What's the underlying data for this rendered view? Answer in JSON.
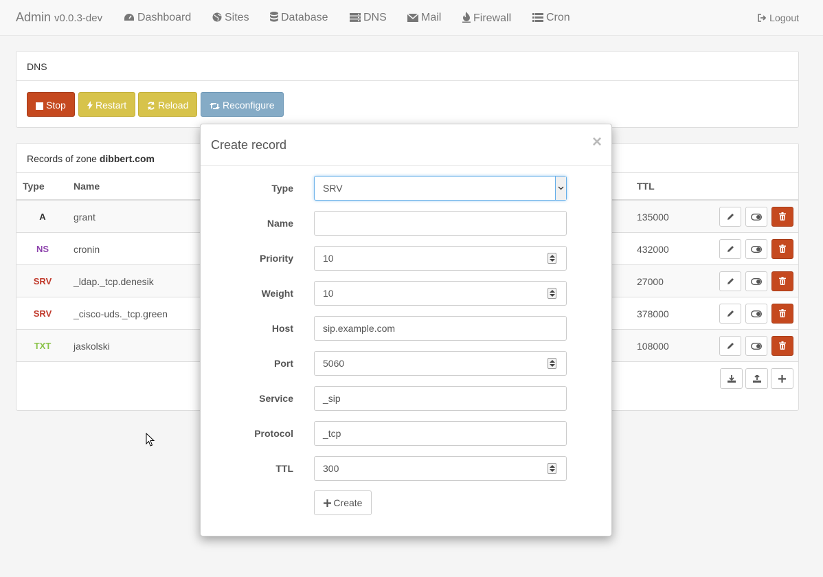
{
  "navbar": {
    "brand": "Admin",
    "version": "v0.0.3-dev",
    "items": [
      {
        "label": "Dashboard",
        "icon": "dashboard-icon"
      },
      {
        "label": "Sites",
        "icon": "globe-icon"
      },
      {
        "label": "Database",
        "icon": "database-icon"
      },
      {
        "label": "DNS",
        "icon": "server-icon"
      },
      {
        "label": "Mail",
        "icon": "envelope-icon"
      },
      {
        "label": "Firewall",
        "icon": "fire-icon"
      },
      {
        "label": "Cron",
        "icon": "list-icon"
      }
    ],
    "logout": "Logout"
  },
  "service_panel": {
    "title": "DNS",
    "buttons": {
      "stop": "Stop",
      "restart": "Restart",
      "reload": "Reload",
      "reconfigure": "Reconfigure"
    }
  },
  "records_panel": {
    "title_prefix": "Records of zone",
    "zone": "dibbert.com",
    "columns": {
      "type": "Type",
      "name": "Name",
      "ttl": "TTL"
    },
    "rows": [
      {
        "type": "A",
        "name": "grant",
        "ttl": "135000",
        "color": "#333333"
      },
      {
        "type": "NS",
        "name": "cronin",
        "ttl": "432000",
        "color": "#8e44ad"
      },
      {
        "type": "SRV",
        "name": "_ldap._tcp.denesik",
        "ttl": "27000",
        "color": "#c0392b"
      },
      {
        "type": "SRV",
        "name": "_cisco-uds._tcp.green",
        "ttl": "378000",
        "color": "#c0392b"
      },
      {
        "type": "TXT",
        "name": "jaskolski",
        "ttl": "108000",
        "color": "#8bc34a"
      }
    ]
  },
  "modal": {
    "title": "Create record",
    "close": "×",
    "fields": {
      "type": {
        "label": "Type",
        "value": "SRV"
      },
      "name": {
        "label": "Name",
        "value": ""
      },
      "priority": {
        "label": "Priority",
        "value": "10"
      },
      "weight": {
        "label": "Weight",
        "value": "10"
      },
      "host": {
        "label": "Host",
        "value": "sip.example.com"
      },
      "port": {
        "label": "Port",
        "value": "5060"
      },
      "service": {
        "label": "Service",
        "value": "_sip"
      },
      "protocol": {
        "label": "Protocol",
        "value": "_tcp"
      },
      "ttl": {
        "label": "TTL",
        "value": "300"
      }
    },
    "create_label": "Create"
  }
}
